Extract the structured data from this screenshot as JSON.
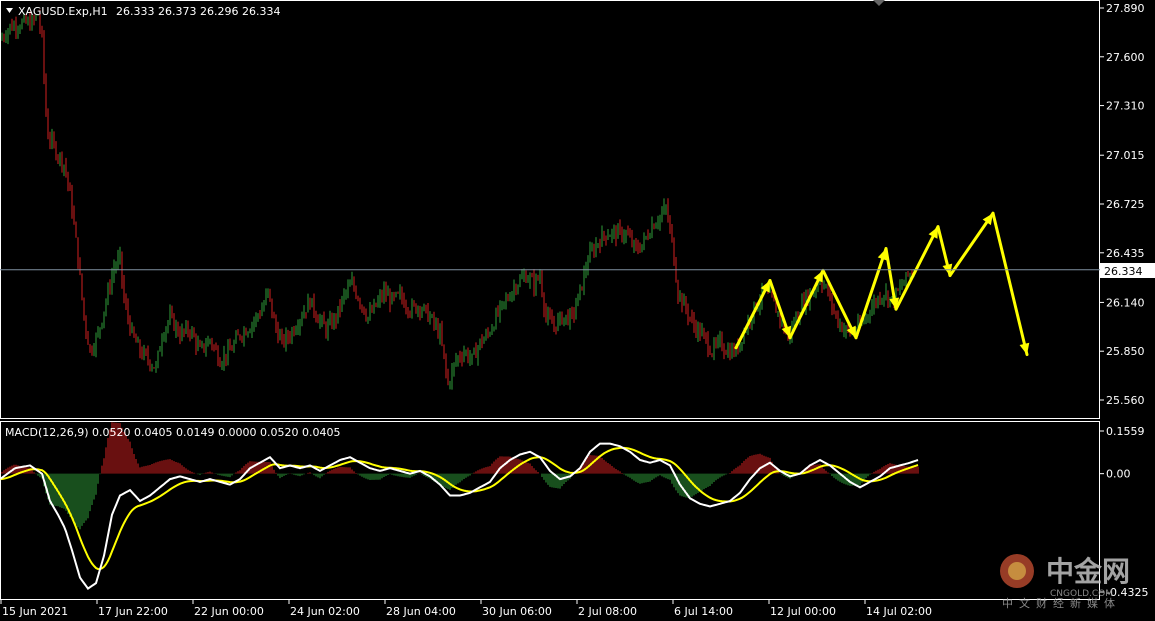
{
  "header": {
    "symbol": "XAGUSD.Exp,H1",
    "ohlc": "26.333 26.373 26.296 26.334"
  },
  "macd_header": {
    "label": "MACD(12,26,9) 0.0520 0.0405 0.0149 0.0000 0.0520 0.0405"
  },
  "colors": {
    "background": "#000000",
    "bull": "#2f9e3a",
    "bear": "#d21f1f",
    "arrow": "#ffff00",
    "signal_line": "#ffff00",
    "macd_line": "#ffffff",
    "bid_line": "#7f8fa0"
  },
  "chart_data": {
    "type": "candlestick",
    "instrument": "XAGUSD.Exp",
    "timeframe": "H1",
    "price_axis_ticks": [
      "27.890",
      "27.600",
      "27.310",
      "27.015",
      "26.725",
      "26.435",
      "26.140",
      "25.850",
      "25.560"
    ],
    "price_range": [
      25.5,
      27.92
    ],
    "current_price": "26.334",
    "time_labels": [
      "15 Jun 2021",
      "17 Jun 22:00",
      "22 Jun 00:00",
      "24 Jun 02:00",
      "28 Jun 04:00",
      "30 Jun 06:00",
      "2 Jul 08:00",
      "6 Jul 14:00",
      "12 Jul 00:00",
      "14 Jul 02:00"
    ],
    "price_path": [
      [
        0,
        27.7
      ],
      [
        10,
        27.78
      ],
      [
        22,
        27.8
      ],
      [
        32,
        27.8
      ],
      [
        38,
        27.85
      ],
      [
        42,
        27.7
      ],
      [
        47,
        27.15
      ],
      [
        55,
        27.05
      ],
      [
        65,
        26.95
      ],
      [
        72,
        26.7
      ],
      [
        78,
        26.4
      ],
      [
        84,
        26.05
      ],
      [
        90,
        25.85
      ],
      [
        98,
        25.95
      ],
      [
        106,
        26.15
      ],
      [
        114,
        26.35
      ],
      [
        120,
        26.4
      ],
      [
        124,
        26.15
      ],
      [
        132,
        25.95
      ],
      [
        140,
        25.85
      ],
      [
        148,
        25.8
      ],
      [
        156,
        25.75
      ],
      [
        162,
        25.95
      ],
      [
        170,
        26.05
      ],
      [
        180,
        25.95
      ],
      [
        190,
        25.98
      ],
      [
        200,
        25.85
      ],
      [
        210,
        25.92
      ],
      [
        220,
        25.8
      ],
      [
        230,
        25.85
      ],
      [
        240,
        25.95
      ],
      [
        250,
        26.0
      ],
      [
        262,
        26.1
      ],
      [
        268,
        26.2
      ],
      [
        275,
        26.0
      ],
      [
        282,
        25.9
      ],
      [
        290,
        25.95
      ],
      [
        300,
        26.05
      ],
      [
        310,
        26.15
      ],
      [
        318,
        26.05
      ],
      [
        326,
        25.98
      ],
      [
        336,
        26.05
      ],
      [
        344,
        26.18
      ],
      [
        352,
        26.25
      ],
      [
        360,
        26.15
      ],
      [
        368,
        26.05
      ],
      [
        376,
        26.12
      ],
      [
        384,
        26.2
      ],
      [
        392,
        26.15
      ],
      [
        400,
        26.18
      ],
      [
        410,
        26.1
      ],
      [
        420,
        26.12
      ],
      [
        430,
        26.05
      ],
      [
        440,
        25.95
      ],
      [
        448,
        25.65
      ],
      [
        456,
        25.8
      ],
      [
        464,
        25.85
      ],
      [
        472,
        25.8
      ],
      [
        480,
        25.9
      ],
      [
        488,
        25.95
      ],
      [
        496,
        26.05
      ],
      [
        506,
        26.15
      ],
      [
        516,
        26.25
      ],
      [
        526,
        26.3
      ],
      [
        534,
        26.25
      ],
      [
        540,
        26.3
      ],
      [
        546,
        26.05
      ],
      [
        554,
        26.0
      ],
      [
        562,
        26.05
      ],
      [
        572,
        26.05
      ],
      [
        580,
        26.2
      ],
      [
        588,
        26.4
      ],
      [
        598,
        26.5
      ],
      [
        606,
        26.55
      ],
      [
        616,
        26.55
      ],
      [
        626,
        26.55
      ],
      [
        636,
        26.45
      ],
      [
        644,
        26.5
      ],
      [
        652,
        26.6
      ],
      [
        660,
        26.65
      ],
      [
        666,
        26.7
      ],
      [
        672,
        26.5
      ],
      [
        678,
        26.2
      ],
      [
        686,
        26.1
      ],
      [
        694,
        26.0
      ],
      [
        702,
        25.95
      ],
      [
        712,
        25.85
      ],
      [
        720,
        25.9
      ],
      [
        728,
        25.85
      ],
      [
        736,
        25.85
      ],
      [
        746,
        26.0
      ],
      [
        754,
        26.1
      ],
      [
        764,
        26.2
      ],
      [
        772,
        26.15
      ],
      [
        780,
        26.05
      ],
      [
        788,
        25.92
      ],
      [
        796,
        26.05
      ],
      [
        804,
        26.15
      ],
      [
        812,
        26.2
      ],
      [
        820,
        26.28
      ],
      [
        828,
        26.2
      ],
      [
        836,
        26.05
      ],
      [
        844,
        25.98
      ],
      [
        852,
        25.95
      ],
      [
        860,
        26.0
      ],
      [
        868,
        26.08
      ],
      [
        876,
        26.15
      ],
      [
        884,
        26.2
      ],
      [
        892,
        26.15
      ],
      [
        900,
        26.22
      ],
      [
        908,
        26.3
      ],
      [
        914,
        26.33
      ]
    ]
  },
  "macd_chart": {
    "axis_ticks": [
      "0.1559",
      "0.00",
      "-0.4325"
    ],
    "range": [
      -0.4325,
      0.1559
    ],
    "line_path": [
      [
        0,
        -0.02
      ],
      [
        15,
        0.02
      ],
      [
        30,
        0.03
      ],
      [
        42,
        0.0
      ],
      [
        50,
        -0.1
      ],
      [
        58,
        -0.15
      ],
      [
        65,
        -0.2
      ],
      [
        72,
        -0.28
      ],
      [
        80,
        -0.38
      ],
      [
        88,
        -0.42
      ],
      [
        96,
        -0.4
      ],
      [
        104,
        -0.3
      ],
      [
        112,
        -0.15
      ],
      [
        120,
        -0.08
      ],
      [
        130,
        -0.06
      ],
      [
        140,
        -0.1
      ],
      [
        150,
        -0.08
      ],
      [
        160,
        -0.05
      ],
      [
        170,
        -0.02
      ],
      [
        180,
        -0.01
      ],
      [
        190,
        -0.02
      ],
      [
        200,
        -0.03
      ],
      [
        210,
        -0.02
      ],
      [
        220,
        -0.03
      ],
      [
        230,
        -0.04
      ],
      [
        240,
        -0.02
      ],
      [
        250,
        0.02
      ],
      [
        260,
        0.04
      ],
      [
        270,
        0.06
      ],
      [
        280,
        0.02
      ],
      [
        290,
        0.03
      ],
      [
        300,
        0.02
      ],
      [
        310,
        0.03
      ],
      [
        320,
        0.01
      ],
      [
        330,
        0.03
      ],
      [
        340,
        0.05
      ],
      [
        350,
        0.06
      ],
      [
        360,
        0.04
      ],
      [
        370,
        0.02
      ],
      [
        380,
        0.01
      ],
      [
        390,
        0.02
      ],
      [
        400,
        0.01
      ],
      [
        410,
        0.0
      ],
      [
        420,
        0.01
      ],
      [
        430,
        -0.01
      ],
      [
        440,
        -0.04
      ],
      [
        450,
        -0.08
      ],
      [
        460,
        -0.08
      ],
      [
        470,
        -0.07
      ],
      [
        480,
        -0.05
      ],
      [
        490,
        -0.03
      ],
      [
        500,
        0.02
      ],
      [
        510,
        0.05
      ],
      [
        520,
        0.07
      ],
      [
        530,
        0.08
      ],
      [
        540,
        0.06
      ],
      [
        550,
        0.01
      ],
      [
        560,
        -0.02
      ],
      [
        570,
        -0.01
      ],
      [
        580,
        0.02
      ],
      [
        590,
        0.08
      ],
      [
        600,
        0.11
      ],
      [
        610,
        0.11
      ],
      [
        620,
        0.1
      ],
      [
        630,
        0.08
      ],
      [
        640,
        0.05
      ],
      [
        650,
        0.04
      ],
      [
        660,
        0.05
      ],
      [
        670,
        0.03
      ],
      [
        680,
        -0.04
      ],
      [
        690,
        -0.09
      ],
      [
        700,
        -0.11
      ],
      [
        710,
        -0.12
      ],
      [
        720,
        -0.11
      ],
      [
        730,
        -0.1
      ],
      [
        740,
        -0.07
      ],
      [
        750,
        -0.02
      ],
      [
        760,
        0.02
      ],
      [
        770,
        0.04
      ],
      [
        780,
        0.01
      ],
      [
        790,
        -0.01
      ],
      [
        800,
        0.0
      ],
      [
        810,
        0.03
      ],
      [
        820,
        0.05
      ],
      [
        830,
        0.03
      ],
      [
        840,
        0.0
      ],
      [
        850,
        -0.03
      ],
      [
        860,
        -0.05
      ],
      [
        870,
        -0.03
      ],
      [
        880,
        -0.01
      ],
      [
        890,
        0.02
      ],
      [
        900,
        0.03
      ],
      [
        910,
        0.04
      ],
      [
        918,
        0.05
      ]
    ]
  },
  "watermark": {
    "logo_text": "中金网",
    "url_text": "CNGOLD.COM",
    "sub_text": "中文财经新媒体"
  }
}
